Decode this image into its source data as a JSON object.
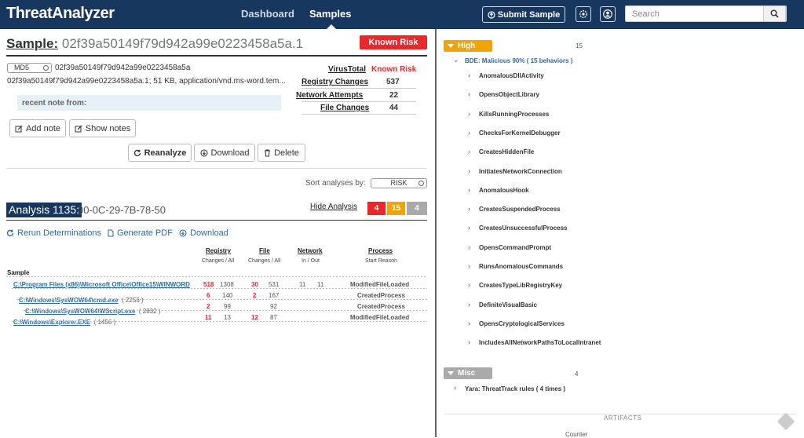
{
  "app": {
    "logo": "ThreatAnalyzer"
  },
  "nav": {
    "dashboard": "Dashboard",
    "samples": "Samples",
    "submit": "Submit Sample",
    "search_placeholder": "Search"
  },
  "sample": {
    "title_label": "Sample:",
    "title_value": "02f39a50149f79d942a99e0223458a5a.1",
    "risk": "Known Risk",
    "hash_type": "MD5",
    "hash": "02f39a50149f79d942a99e0223458a5a",
    "file_info": "02f39a50149f79d942a99e0223458a5a.1; 51 KB, application/vnd.ms-word.tem...",
    "note_label": "recent note from:",
    "virustotal_label": "VirusTotal",
    "virustotal_value": "Known Risk",
    "stats": [
      {
        "label": "Registry Changes",
        "value": "537"
      },
      {
        "label": "Network Attempts",
        "value": "22"
      },
      {
        "label": "File Changes",
        "value": "44"
      }
    ],
    "buttons": {
      "add_note": "Add note",
      "show_notes": "Show notes",
      "reanalyze": "Reanalyze",
      "download": "Download",
      "delete": "Delete"
    }
  },
  "sort": {
    "label": "Sort analyses by:",
    "value": "RISK"
  },
  "analysis": {
    "title": "Analysis 1135:",
    "mac": "00-0C-29-7B-78-50",
    "hide": "Hide Analysis",
    "counts": [
      "4",
      "15",
      "4"
    ],
    "actions": {
      "rerun": "Rerun Determinations",
      "pdf": "Generate PDF",
      "download": "Download"
    },
    "headers": {
      "registry": "Registry",
      "registry_sub": "Changes / All",
      "file": "File",
      "file_sub": "Changes / All",
      "network": "Network",
      "network_sub": "In / Out",
      "process": "Process",
      "process_sub": "Start Reason",
      "sample": "Sample"
    },
    "rows": [
      {
        "path": "C:\\Program Files (x86)\\Microsoft Office\\Office15\\WINWORD",
        "pid": "",
        "reg_c": "518",
        "reg_a": "1308",
        "file_c": "30",
        "file_a": "531",
        "net_in": "11",
        "net_out": "11",
        "reason": "ModifiedFileLoaded"
      },
      {
        "path": "C:\\Windows\\SysWOW64\\cmd.exe",
        "pid": "( 2256 )",
        "reg_c": "6",
        "reg_a": "140",
        "file_c": "2",
        "file_a": "167",
        "net_in": "",
        "net_out": "",
        "reason": "CreatedProcess"
      },
      {
        "path": "C:\\Windows\\SysWOW64\\WScript.exe",
        "pid": "( 2832 )",
        "reg_c": "2",
        "reg_a": "99",
        "file_c": "",
        "file_a": "92",
        "net_in": "",
        "net_out": "",
        "reason": "CreatedProcess"
      },
      {
        "path": "C:\\Windows\\Explorer.EXE",
        "pid": "( 1456 )",
        "reg_c": "11",
        "reg_a": "13",
        "file_c": "12",
        "file_a": "87",
        "net_in": "",
        "net_out": "",
        "reason": "ModifiedFileLoaded"
      }
    ]
  },
  "behaviors": {
    "high": {
      "label": "High",
      "count": "15",
      "group": "BDE: Malicious 90% ( 15 behaviors )",
      "items": [
        "AnomalousDllActivity",
        "OpensObjectLibrary",
        "KillsRunningProcesses",
        "ChecksForKernelDebugger",
        "CreatesHiddenFile",
        "InitiatesNetworkConnection",
        "AnomalousHook",
        "CreatesSuspendedProcess",
        "CreatesUnsuccessfulProcess",
        "OpensCommandPrompt",
        "RunsAnomalousCommands",
        "CreatesTypeLibRegistryKey",
        "DefiniteVisualBasic",
        "OpensCryptologicalServices",
        "IncludesAllNetworkPathsToLocalIntranet"
      ]
    },
    "misc": {
      "label": "Misc",
      "count": "4",
      "item": "Yara: ThreatTrack rules ( 4 times )"
    },
    "artifacts": "ARTIFACTS",
    "counter": "Counter"
  },
  "colors": {
    "navy": "#17375e",
    "red": "#e8282b",
    "orange": "#f0a30a",
    "gray": "#aaaaaa",
    "link": "#2c6aa0"
  }
}
